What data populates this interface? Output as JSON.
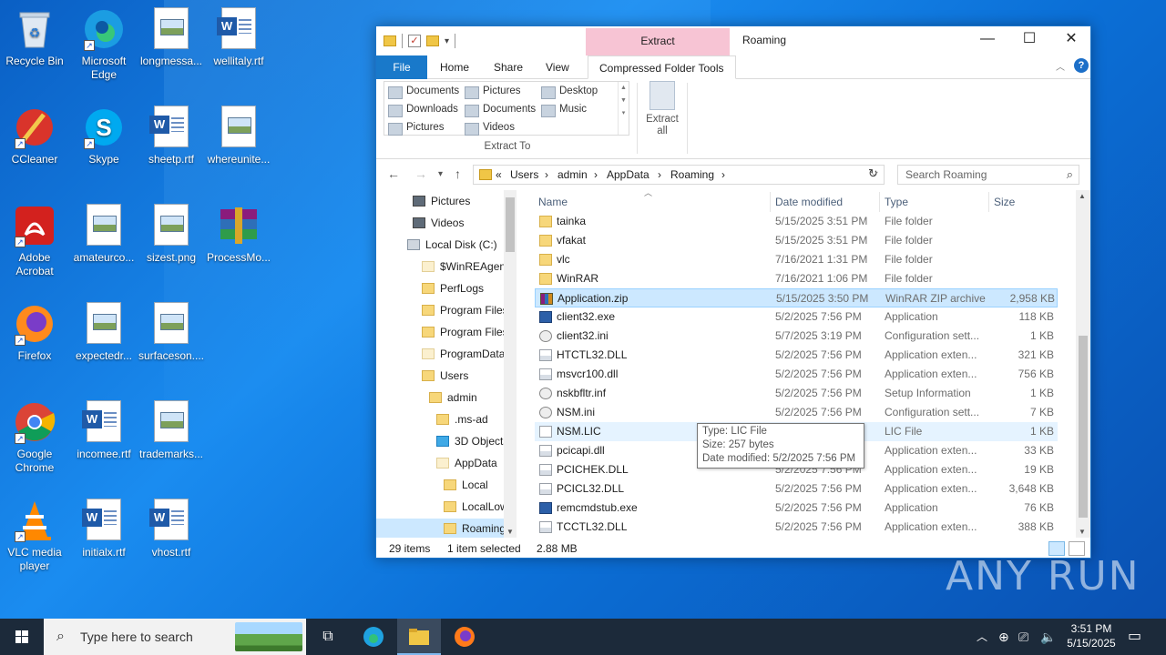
{
  "desktop": {
    "icons": [
      {
        "label": "Recycle Bin"
      },
      {
        "label": "Microsoft Edge"
      },
      {
        "label": "longmessa..."
      },
      {
        "label": "wellitaly.rtf"
      },
      {
        "label": "CCleaner"
      },
      {
        "label": "Skype"
      },
      {
        "label": "sheetp.rtf"
      },
      {
        "label": "whereunite..."
      },
      {
        "label": "Adobe Acrobat"
      },
      {
        "label": "amateurco..."
      },
      {
        "label": "sizest.png"
      },
      {
        "label": "ProcessMo..."
      },
      {
        "label": "Firefox"
      },
      {
        "label": "expectedr..."
      },
      {
        "label": "surfaceson...."
      },
      {
        "label": "Google Chrome"
      },
      {
        "label": "incomee.rtf"
      },
      {
        "label": "trademarks..."
      },
      {
        "label": "VLC media player"
      },
      {
        "label": "initialx.rtf"
      },
      {
        "label": "vhost.rtf"
      }
    ]
  },
  "window": {
    "context_tab": "Extract",
    "title": "Roaming",
    "buttons": {
      "minimize": "—",
      "maximize": "☐",
      "close": "✕"
    },
    "ribbon_tabs": [
      "File",
      "Home",
      "Share",
      "View",
      "Compressed Folder Tools"
    ],
    "gallery": [
      "Documents",
      "Pictures",
      "Desktop",
      "Downloads",
      "Documents",
      "Music",
      "Pictures",
      "Videos"
    ],
    "extract_to_label": "Extract To",
    "extract_all_label": "Extract all",
    "address": {
      "prefix": "«",
      "crumbs": [
        "Users",
        "admin",
        "AppData",
        "Roaming"
      ],
      "sep": "›"
    },
    "search_placeholder": "Search Roaming",
    "nav_tree": [
      {
        "label": "Pictures",
        "icon": "pictures"
      },
      {
        "label": "Videos",
        "icon": "videos"
      },
      {
        "label": "Local Disk (C:)",
        "icon": "disk"
      },
      {
        "label": "$WinREAgent",
        "icon": "pale"
      },
      {
        "label": "PerfLogs",
        "icon": "folder"
      },
      {
        "label": "Program Files",
        "icon": "folder"
      },
      {
        "label": "Program Files",
        "icon": "folder"
      },
      {
        "label": "ProgramData",
        "icon": "pale"
      },
      {
        "label": "Users",
        "icon": "folder"
      },
      {
        "label": "admin",
        "icon": "folder"
      },
      {
        "label": ".ms-ad",
        "icon": "folder"
      },
      {
        "label": "3D Objects",
        "icon": "cube"
      },
      {
        "label": "AppData",
        "icon": "pale"
      },
      {
        "label": "Local",
        "icon": "folder"
      },
      {
        "label": "LocalLow",
        "icon": "folder"
      },
      {
        "label": "Roaming",
        "icon": "folder"
      }
    ],
    "columns": {
      "name": "Name",
      "date": "Date modified",
      "type": "Type",
      "size": "Size"
    },
    "files": [
      {
        "name": "tainka",
        "date": "5/15/2025 3:51 PM",
        "type": "File folder",
        "size": "",
        "icon": "folder"
      },
      {
        "name": "vfakat",
        "date": "5/15/2025 3:51 PM",
        "type": "File folder",
        "size": "",
        "icon": "folder"
      },
      {
        "name": "vlc",
        "date": "7/16/2021 1:31 PM",
        "type": "File folder",
        "size": "",
        "icon": "folder"
      },
      {
        "name": "WinRAR",
        "date": "7/16/2021 1:06 PM",
        "type": "File folder",
        "size": "",
        "icon": "folder"
      },
      {
        "name": "Application.zip",
        "date": "5/15/2025 3:50 PM",
        "type": "WinRAR ZIP archive",
        "size": "2,958 KB",
        "icon": "zip"
      },
      {
        "name": "client32.exe",
        "date": "5/2/2025 7:56 PM",
        "type": "Application",
        "size": "118 KB",
        "icon": "exe"
      },
      {
        "name": "client32.ini",
        "date": "5/7/2025 3:19 PM",
        "type": "Configuration sett...",
        "size": "1 KB",
        "icon": "cfg"
      },
      {
        "name": "HTCTL32.DLL",
        "date": "5/2/2025 7:56 PM",
        "type": "Application exten...",
        "size": "321 KB",
        "icon": "dll"
      },
      {
        "name": "msvcr100.dll",
        "date": "5/2/2025 7:56 PM",
        "type": "Application exten...",
        "size": "756 KB",
        "icon": "dll"
      },
      {
        "name": "nskbfltr.inf",
        "date": "5/2/2025 7:56 PM",
        "type": "Setup Information",
        "size": "1 KB",
        "icon": "cfg"
      },
      {
        "name": "NSM.ini",
        "date": "5/2/2025 7:56 PM",
        "type": "Configuration sett...",
        "size": "7 KB",
        "icon": "cfg"
      },
      {
        "name": "NSM.LIC",
        "date": "",
        "type": "LIC File",
        "size": "1 KB",
        "icon": "doc"
      },
      {
        "name": "pcicapi.dll",
        "date": "",
        "type": "Application exten...",
        "size": "33 KB",
        "icon": "dll"
      },
      {
        "name": "PCICHEK.DLL",
        "date": "5/2/2025 7:56 PM",
        "type": "Application exten...",
        "size": "19 KB",
        "icon": "dll"
      },
      {
        "name": "PCICL32.DLL",
        "date": "5/2/2025 7:56 PM",
        "type": "Application exten...",
        "size": "3,648 KB",
        "icon": "dll"
      },
      {
        "name": "remcmdstub.exe",
        "date": "5/2/2025 7:56 PM",
        "type": "Application",
        "size": "76 KB",
        "icon": "exe"
      },
      {
        "name": "TCCTL32.DLL",
        "date": "5/2/2025 7:56 PM",
        "type": "Application exten...",
        "size": "388 KB",
        "icon": "dll"
      }
    ],
    "tooltip": {
      "line1": "Type: LIC File",
      "line2": "Size: 257 bytes",
      "line3": "Date modified: 5/2/2025 7:56 PM"
    },
    "status": {
      "items": "29 items",
      "selected": "1 item selected",
      "size": "2.88 MB"
    }
  },
  "watermark": "ANY RUN",
  "taskbar": {
    "search_placeholder": "Type here to search",
    "time": "3:51 PM",
    "date": "5/15/2025"
  }
}
